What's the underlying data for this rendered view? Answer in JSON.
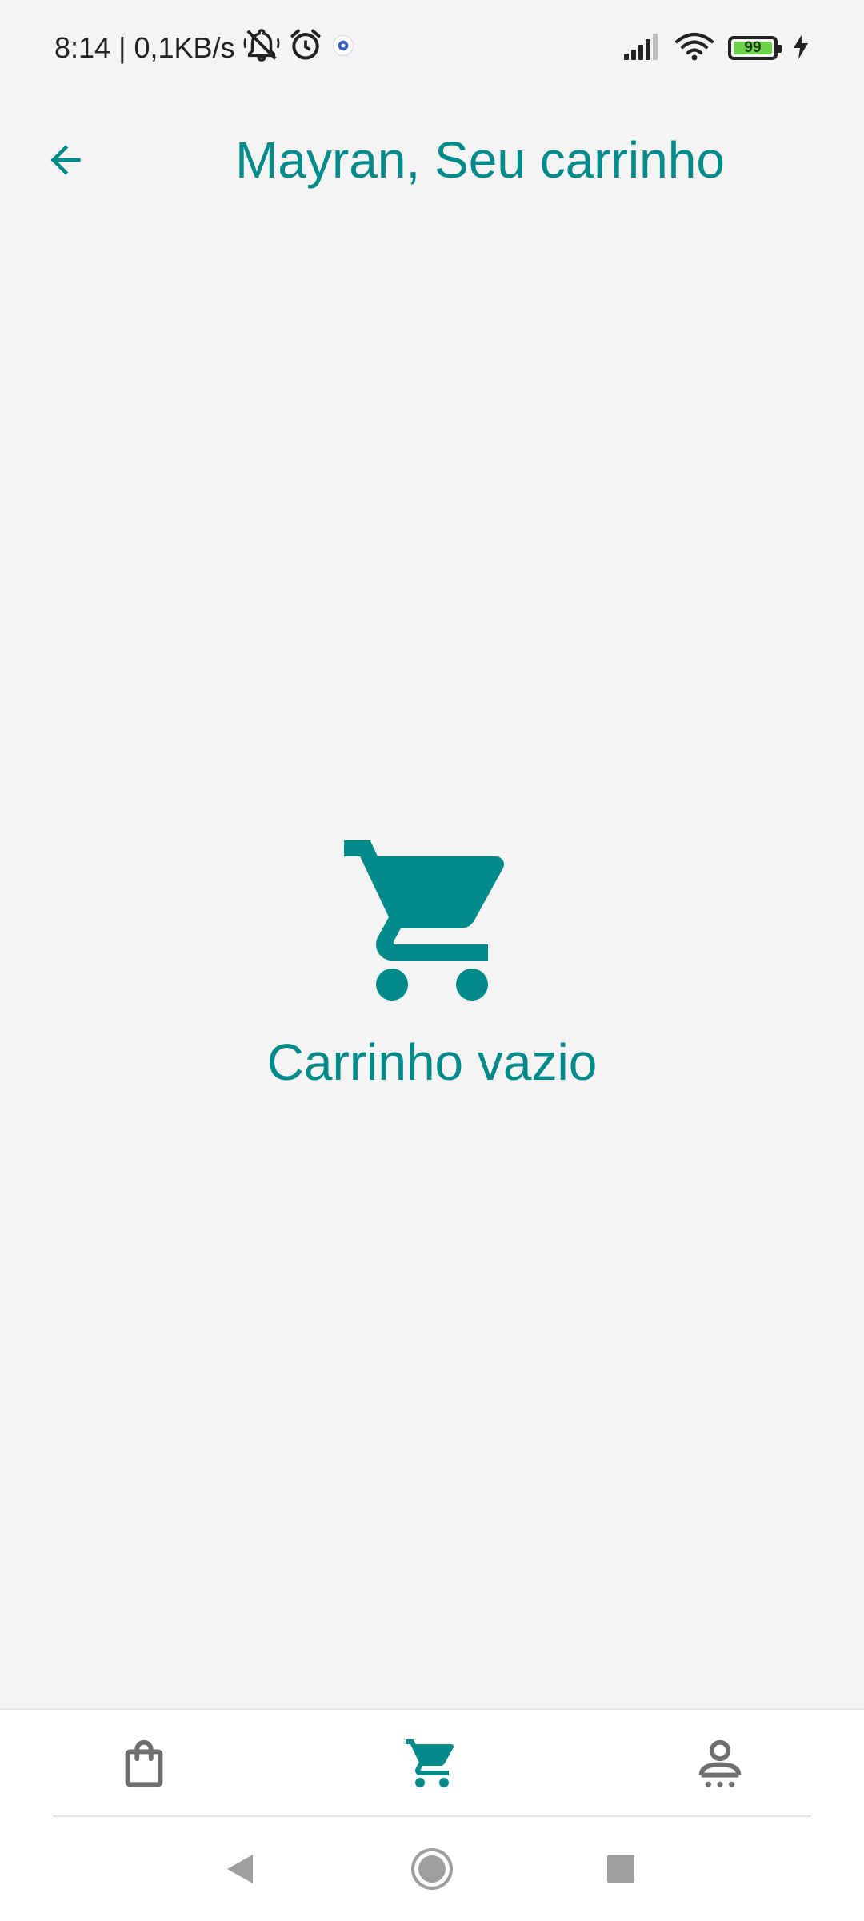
{
  "status_bar": {
    "time": "8:14",
    "separator": "|",
    "network_speed": "0,1KB/s",
    "battery_level": "99",
    "icons": [
      "mute-icon",
      "alarm-icon",
      "app-notification-icon",
      "signal-icon",
      "wifi-icon",
      "battery-icon",
      "charging-icon"
    ]
  },
  "header": {
    "title": "Mayran, Seu carrinho",
    "back_icon": "arrow-left-icon"
  },
  "empty_state": {
    "icon": "shopping-cart-icon",
    "label": "Carrinho vazio"
  },
  "bottom_nav": {
    "items": [
      {
        "icon": "shopping-bag-icon",
        "active": false
      },
      {
        "icon": "shopping-cart-icon",
        "active": true
      },
      {
        "icon": "profile-icon",
        "active": false
      }
    ]
  },
  "system_nav": {
    "buttons": [
      "back-triangle-icon",
      "home-circle-icon",
      "recents-square-icon"
    ]
  },
  "colors": {
    "accent": "#008a8a",
    "background": "#f4f4f4",
    "nav_inactive": "#6f6f6f",
    "system_nav_icon": "#9e9e9e"
  }
}
